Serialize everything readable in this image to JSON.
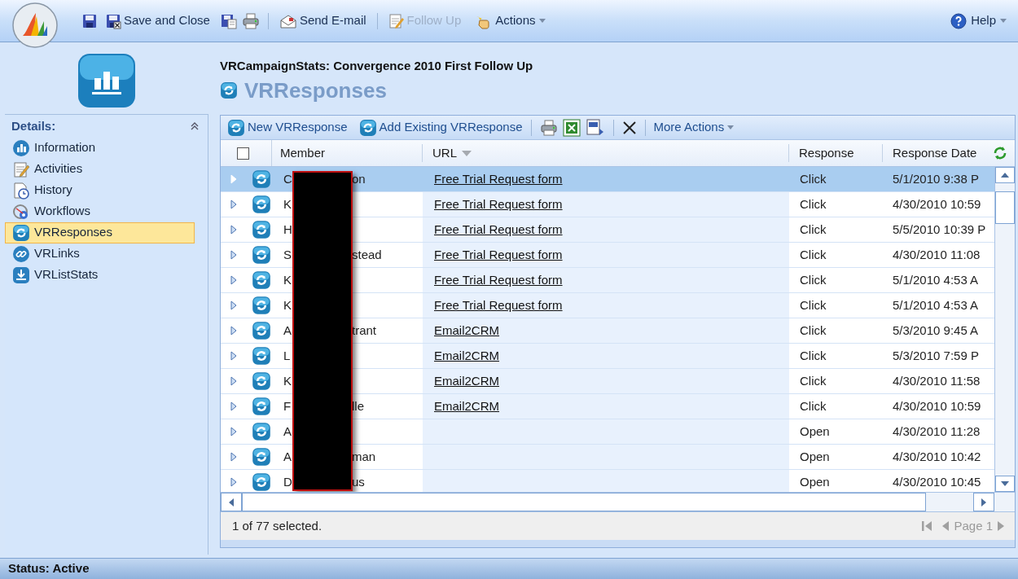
{
  "toolbar": {
    "save_and_close": "Save and Close",
    "send_email": "Send E-mail",
    "follow_up": {
      "label": "Follow Up",
      "disabled": true
    },
    "actions": "Actions",
    "help": "Help"
  },
  "header": {
    "record_title": "VRCampaignStats: Convergence 2010 First Follow Up",
    "entity_title": "VRResponses"
  },
  "sidebar": {
    "title": "Details:",
    "items": [
      {
        "label": "Information",
        "selected": false
      },
      {
        "label": "Activities",
        "selected": false
      },
      {
        "label": "History",
        "selected": false
      },
      {
        "label": "Workflows",
        "selected": false
      },
      {
        "label": "VRResponses",
        "selected": true
      },
      {
        "label": "VRLinks",
        "selected": false
      },
      {
        "label": "VRListStats",
        "selected": false
      }
    ]
  },
  "grid": {
    "toolbar": {
      "new": "New VRResponse",
      "add_existing": "Add Existing VRResponse",
      "more_actions": "More Actions"
    },
    "header_checkbox": {
      "checked": false
    },
    "columns": [
      "Member",
      "URL",
      "Response",
      "Response Date"
    ],
    "rows": [
      {
        "member_start": "C",
        "member_end": "on",
        "url": "Free Trial Request form",
        "response": "Click",
        "date": "5/1/2010 9:38 P",
        "selected": true
      },
      {
        "member_start": "K",
        "member_end": "",
        "url": "Free Trial Request form",
        "response": "Click",
        "date": "4/30/2010 10:59",
        "selected": false
      },
      {
        "member_start": "H",
        "member_end": "",
        "url": "Free Trial Request form",
        "response": "Click",
        "date": "5/5/2010 10:39 P",
        "selected": false
      },
      {
        "member_start": "S",
        "member_end": "stead",
        "url": "Free Trial Request form",
        "response": "Click",
        "date": "4/30/2010 11:08",
        "selected": false
      },
      {
        "member_start": "K",
        "member_end": "",
        "url": "Free Trial Request form",
        "response": "Click",
        "date": "5/1/2010 4:53 A",
        "selected": false
      },
      {
        "member_start": "K",
        "member_end": "",
        "url": "Free Trial Request form",
        "response": "Click",
        "date": "5/1/2010 4:53 A",
        "selected": false
      },
      {
        "member_start": "A",
        "member_end": "trant",
        "url": "Email2CRM",
        "response": "Click",
        "date": "5/3/2010 9:45 A",
        "selected": false
      },
      {
        "member_start": "L",
        "member_end": "",
        "url": "Email2CRM",
        "response": "Click",
        "date": "5/3/2010 7:59 P",
        "selected": false
      },
      {
        "member_start": "K",
        "member_end": "",
        "url": "Email2CRM",
        "response": "Click",
        "date": "4/30/2010 11:58",
        "selected": false
      },
      {
        "member_start": "F",
        "member_end": "lle",
        "url": "Email2CRM",
        "response": "Click",
        "date": "4/30/2010 10:59",
        "selected": false
      },
      {
        "member_start": "A",
        "member_end": "",
        "url": "",
        "response": "Open",
        "date": "4/30/2010 11:28",
        "selected": false
      },
      {
        "member_start": "A",
        "member_end": "man",
        "url": "",
        "response": "Open",
        "date": "4/30/2010 10:42",
        "selected": false
      },
      {
        "member_start": "D",
        "member_end": "us",
        "url": "",
        "response": "Open",
        "date": "4/30/2010 10:45",
        "selected": false
      }
    ],
    "selection_count": "1 of 77 selected.",
    "page": "Page 1"
  },
  "status_bar": "Status: Active"
}
